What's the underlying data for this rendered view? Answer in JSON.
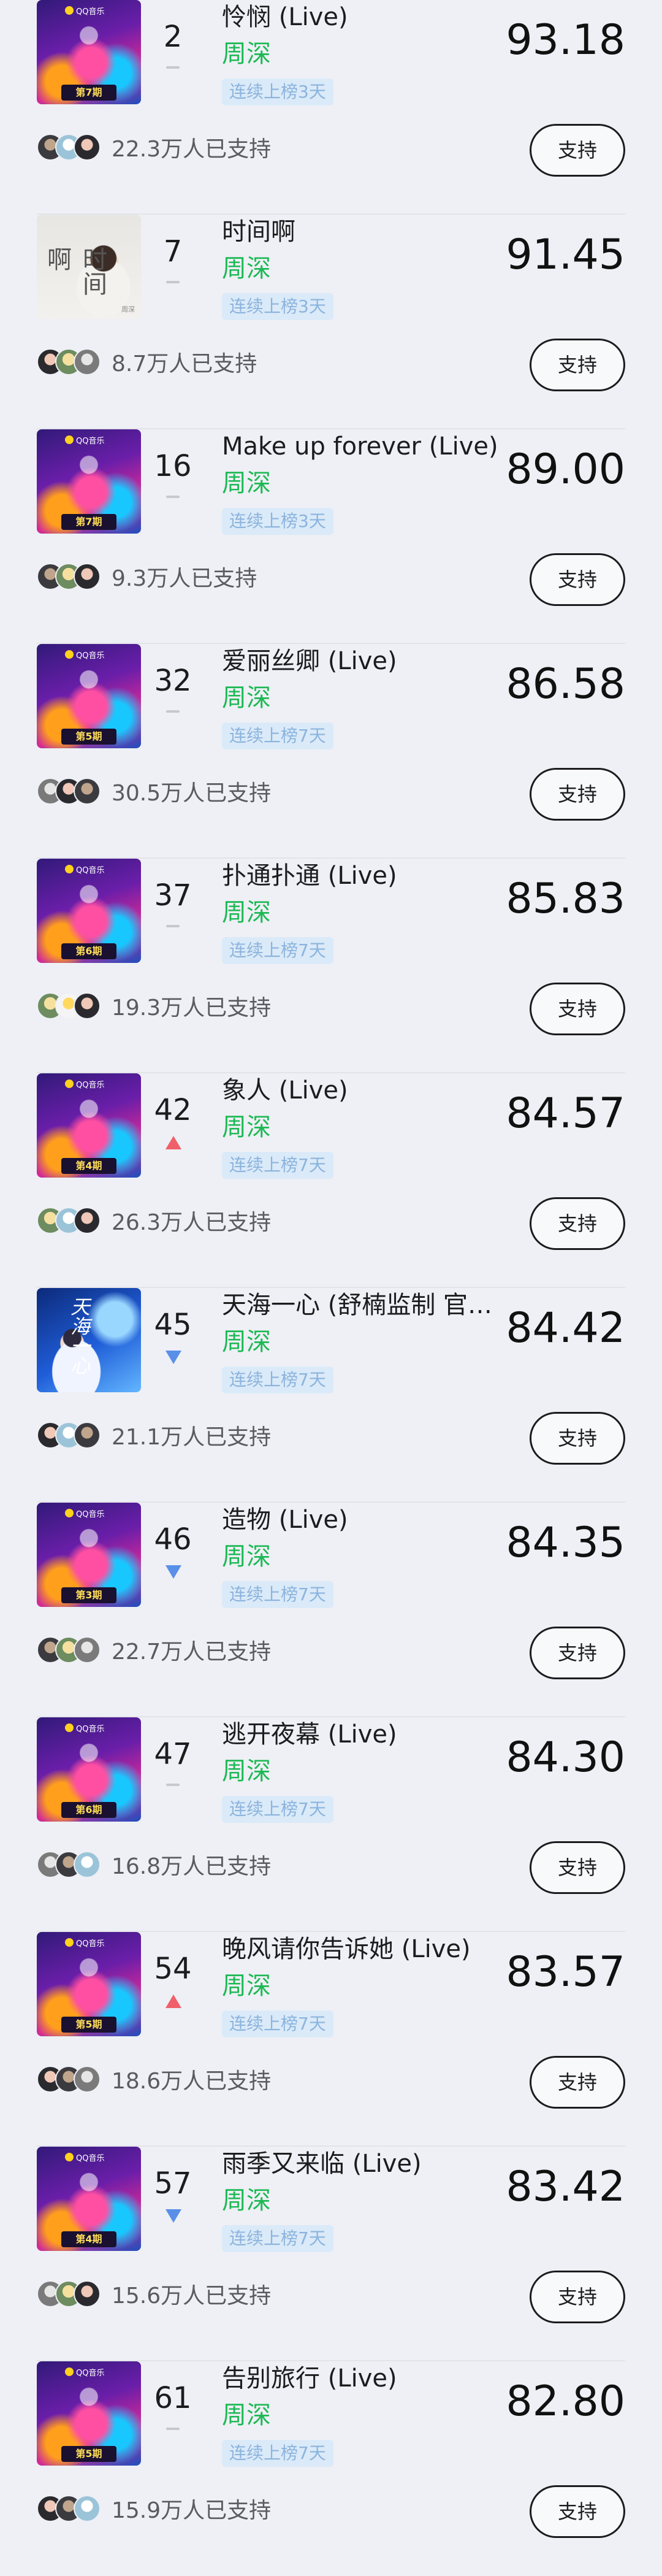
{
  "colors": {
    "background": "#eef0f5",
    "artist": "#1db954",
    "streak_bg": "#dbeaf8",
    "streak_text": "#8bb4de",
    "trend_up": "#f0606a",
    "trend_down": "#5a8fe8",
    "trend_flat": "#c8c8cc"
  },
  "entries": [
    {
      "rank": "2",
      "trend": "flat",
      "title": "怜悯 (Live)",
      "artist": "周深",
      "streak": "连续上榜3天",
      "score": "93.18",
      "supporters": "22.3万人已支持",
      "support_label": "支持",
      "cover": {
        "style": "show",
        "logo": "QQ音乐",
        "banner": "第7期"
      },
      "avatars": [
        "a1",
        "a2",
        "a3"
      ]
    },
    {
      "rank": "7",
      "trend": "flat",
      "title": "时间啊",
      "artist": "周深",
      "streak": "连续上榜3天",
      "score": "91.45",
      "supporters": "8.7万人已支持",
      "support_label": "支持",
      "cover": {
        "style": "portrait-light",
        "text": "时间啊",
        "sig": "周深"
      },
      "avatars": [
        "a3",
        "a4",
        "a5"
      ]
    },
    {
      "rank": "16",
      "trend": "flat",
      "title": "Make up forever (Live)",
      "artist": "周深",
      "streak": "连续上榜3天",
      "score": "89.00",
      "supporters": "9.3万人已支持",
      "support_label": "支持",
      "cover": {
        "style": "show",
        "logo": "QQ音乐",
        "banner": "第7期"
      },
      "avatars": [
        "a1",
        "a4",
        "a3"
      ]
    },
    {
      "rank": "32",
      "trend": "flat",
      "title": "爱丽丝卿 (Live)",
      "artist": "周深",
      "streak": "连续上榜7天",
      "score": "86.58",
      "supporters": "30.5万人已支持",
      "support_label": "支持",
      "cover": {
        "style": "show",
        "logo": "QQ音乐",
        "banner": "第5期"
      },
      "avatars": [
        "a5",
        "a3",
        "a1"
      ]
    },
    {
      "rank": "37",
      "trend": "flat",
      "title": "扑通扑通 (Live)",
      "artist": "周深",
      "streak": "连续上榜7天",
      "score": "85.83",
      "supporters": "19.3万人已支持",
      "support_label": "支持",
      "cover": {
        "style": "show",
        "logo": "QQ音乐",
        "banner": "第6期"
      },
      "avatars": [
        "a4",
        "a6",
        "a3"
      ]
    },
    {
      "rank": "42",
      "trend": "up",
      "title": "象人 (Live)",
      "artist": "周深",
      "streak": "连续上榜7天",
      "score": "84.57",
      "supporters": "26.3万人已支持",
      "support_label": "支持",
      "cover": {
        "style": "show",
        "logo": "QQ音乐",
        "banner": "第4期"
      },
      "avatars": [
        "a4",
        "a2",
        "a3"
      ]
    },
    {
      "rank": "45",
      "trend": "down",
      "title": "天海一心 (舒楠监制 官方正式版)",
      "artist": "周深",
      "streak": "连续上榜7天",
      "score": "84.42",
      "supporters": "21.1万人已支持",
      "support_label": "支持",
      "cover": {
        "style": "portrait-blue",
        "text": "天海一心"
      },
      "avatars": [
        "a3",
        "a2",
        "a1"
      ]
    },
    {
      "rank": "46",
      "trend": "down",
      "title": "造物 (Live)",
      "artist": "周深",
      "streak": "连续上榜7天",
      "score": "84.35",
      "supporters": "22.7万人已支持",
      "support_label": "支持",
      "cover": {
        "style": "show",
        "logo": "QQ音乐",
        "banner": "第3期"
      },
      "avatars": [
        "a1",
        "a4",
        "a5"
      ]
    },
    {
      "rank": "47",
      "trend": "flat",
      "title": "逃开夜幕 (Live)",
      "artist": "周深",
      "streak": "连续上榜7天",
      "score": "84.30",
      "supporters": "16.8万人已支持",
      "support_label": "支持",
      "cover": {
        "style": "show",
        "logo": "QQ音乐",
        "banner": "第6期"
      },
      "avatars": [
        "a5",
        "a1",
        "a2"
      ]
    },
    {
      "rank": "54",
      "trend": "up",
      "title": "晚风请你告诉她 (Live)",
      "artist": "周深",
      "streak": "连续上榜7天",
      "score": "83.57",
      "supporters": "18.6万人已支持",
      "support_label": "支持",
      "cover": {
        "style": "show",
        "logo": "QQ音乐",
        "banner": "第5期"
      },
      "avatars": [
        "a3",
        "a1",
        "a5"
      ]
    },
    {
      "rank": "57",
      "trend": "down",
      "title": "雨季又来临 (Live)",
      "artist": "周深",
      "streak": "连续上榜7天",
      "score": "83.42",
      "supporters": "15.6万人已支持",
      "support_label": "支持",
      "cover": {
        "style": "show",
        "logo": "QQ音乐",
        "banner": "第4期"
      },
      "avatars": [
        "a5",
        "a4",
        "a3"
      ]
    },
    {
      "rank": "61",
      "trend": "flat",
      "title": "告别旅行 (Live)",
      "artist": "周深",
      "streak": "连续上榜7天",
      "score": "82.80",
      "supporters": "15.9万人已支持",
      "support_label": "支持",
      "cover": {
        "style": "show",
        "logo": "QQ音乐",
        "banner": "第5期"
      },
      "avatars": [
        "a3",
        "a1",
        "a2"
      ]
    }
  ]
}
